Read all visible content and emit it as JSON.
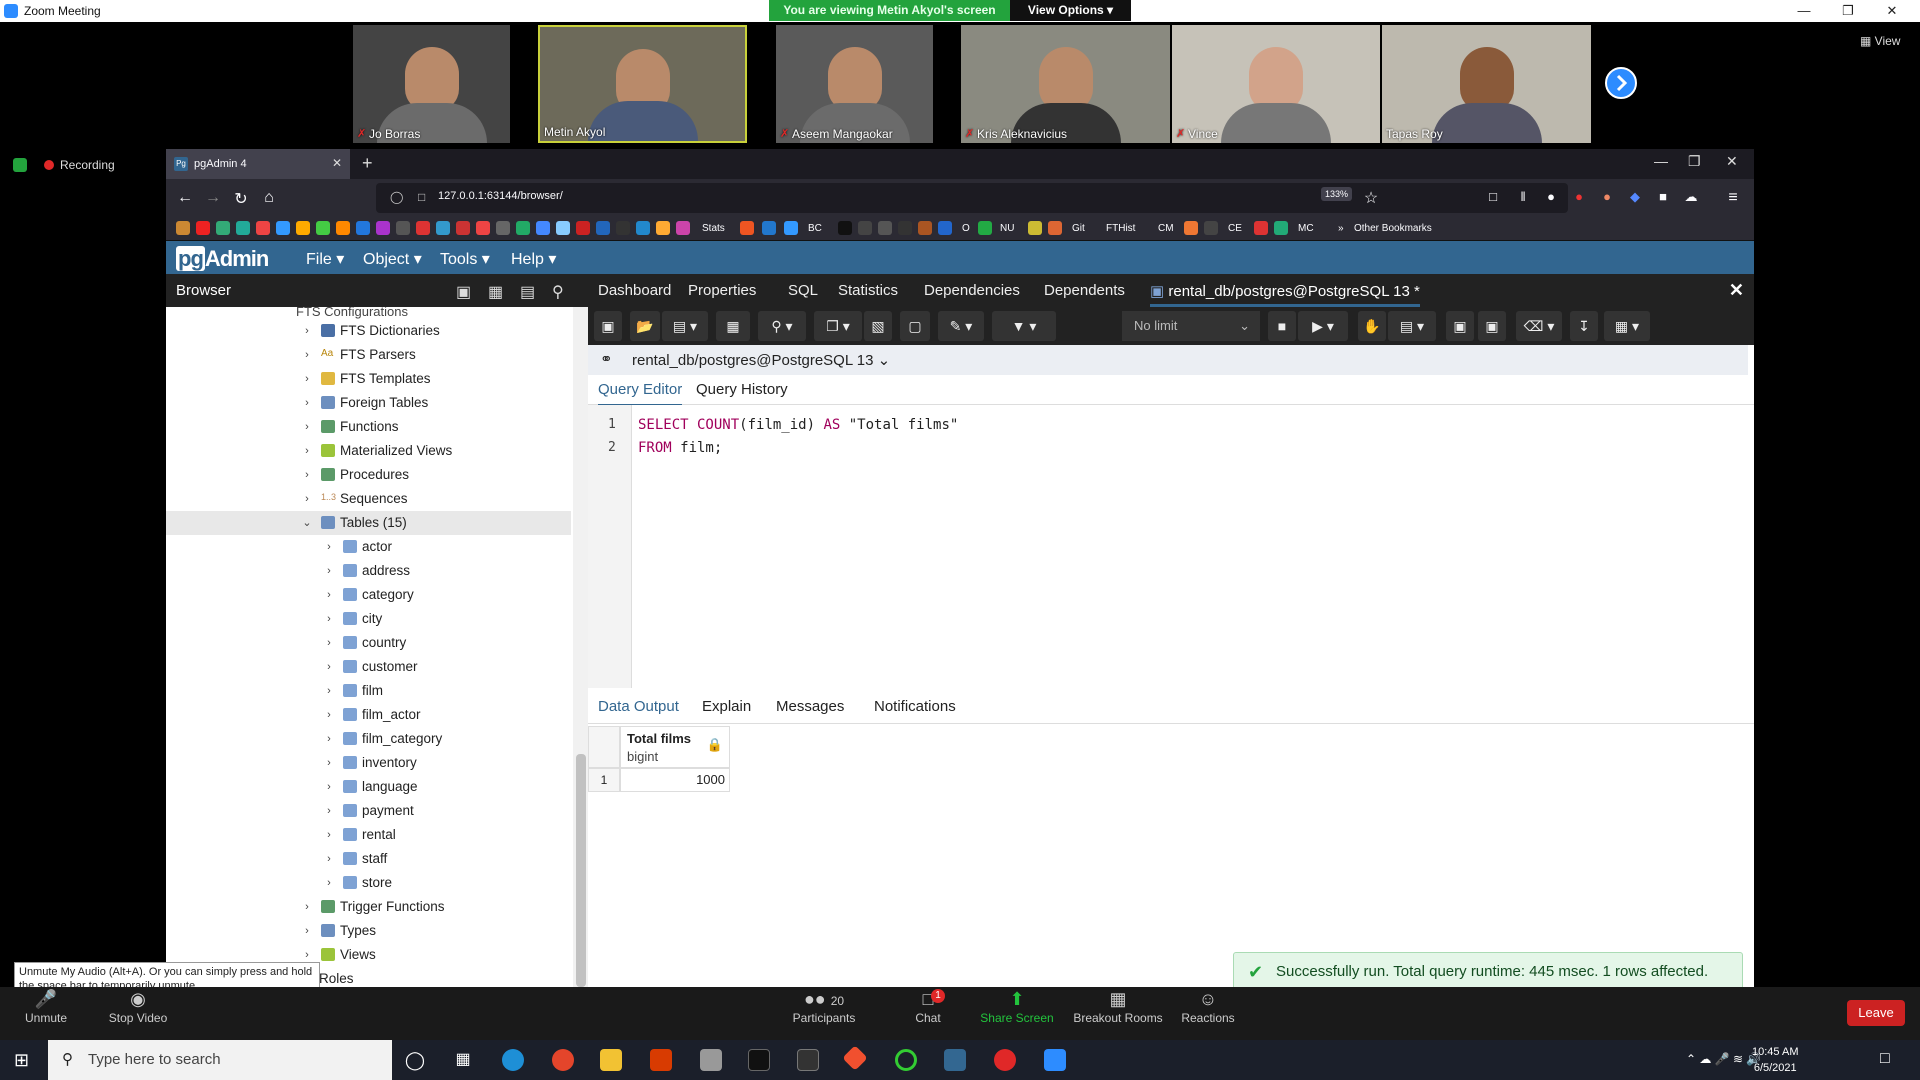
{
  "zoom": {
    "window_title": "Zoom Meeting",
    "banner": "You are viewing Metin Akyol's screen",
    "view_options": "View Options",
    "view": "View",
    "recording": "Recording",
    "participants": [
      {
        "name": "Jo Borras"
      },
      {
        "name": "Metin Akyol"
      },
      {
        "name": "Aseem Mangaokar"
      },
      {
        "name": "Kris Aleknavicius"
      },
      {
        "name": "Vince"
      },
      {
        "name": "Tapas Roy"
      }
    ],
    "tooltip": "Unmute My Audio (Alt+A). Or you can simply press and hold the space bar to temporarily unmute.",
    "controls": {
      "unmute": "Unmute",
      "stop_video": "Stop Video",
      "participants": "Participants",
      "participants_count": "20",
      "chat": "Chat",
      "chat_badge": "1",
      "share_screen": "Share Screen",
      "breakout_rooms": "Breakout Rooms",
      "reactions": "Reactions",
      "leave": "Leave"
    }
  },
  "browser": {
    "tab_title": "pgAdmin 4",
    "url": "127.0.0.1:63144/browser/",
    "zoom": "133%",
    "bookmarks": [
      "Stats",
      "BC",
      "O",
      "NU",
      "Git",
      "FTHist",
      "CM",
      "CE",
      "MC",
      "Other Bookmarks"
    ]
  },
  "pgadmin": {
    "logo_pg": "pg",
    "logo_admin": "Admin",
    "menus": [
      "File",
      "Object",
      "Tools",
      "Help"
    ],
    "browser_title": "Browser",
    "tree_top_partial": "FTS Configurations",
    "tree_items": [
      "FTS Dictionaries",
      "FTS Parsers",
      "FTS Templates",
      "Foreign Tables",
      "Functions",
      "Materialized Views",
      "Procedures",
      "Sequences"
    ],
    "tables_label": "Tables (15)",
    "tables": [
      "actor",
      "address",
      "category",
      "city",
      "country",
      "customer",
      "film",
      "film_actor",
      "film_category",
      "inventory",
      "language",
      "payment",
      "rental",
      "staff",
      "store"
    ],
    "tree_after": [
      "Trigger Functions",
      "Types",
      "Views"
    ],
    "tree_bottom_partial": "Roles",
    "panel_tabs": [
      "Dashboard",
      "Properties",
      "SQL",
      "Statistics",
      "Dependencies",
      "Dependents"
    ],
    "query_tab": "rental_db/postgres@PostgreSQL 13 *",
    "row_limit": "No limit",
    "connection": "rental_db/postgres@PostgreSQL 13",
    "editor_tabs": [
      "Query Editor",
      "Query History"
    ],
    "lines": [
      {
        "num": "1",
        "kw1": "SELECT COUNT",
        "rest": "(film_id) ",
        "kw2": "AS",
        "tail": " \"Total films\""
      },
      {
        "num": "2",
        "kw1": "FROM",
        "rest": " film;",
        "kw2": "",
        "tail": ""
      }
    ],
    "output_tabs": [
      "Data Output",
      "Explain",
      "Messages",
      "Notifications"
    ],
    "column_name": "Total films",
    "column_type": "bigint",
    "row_number": "1",
    "cell_value": "1000",
    "toast": "Successfully run. Total query runtime: 445 msec. 1 rows affected."
  },
  "taskbar": {
    "search_placeholder": "Type here to search",
    "time": "10:45 AM",
    "date": "6/5/2021"
  }
}
